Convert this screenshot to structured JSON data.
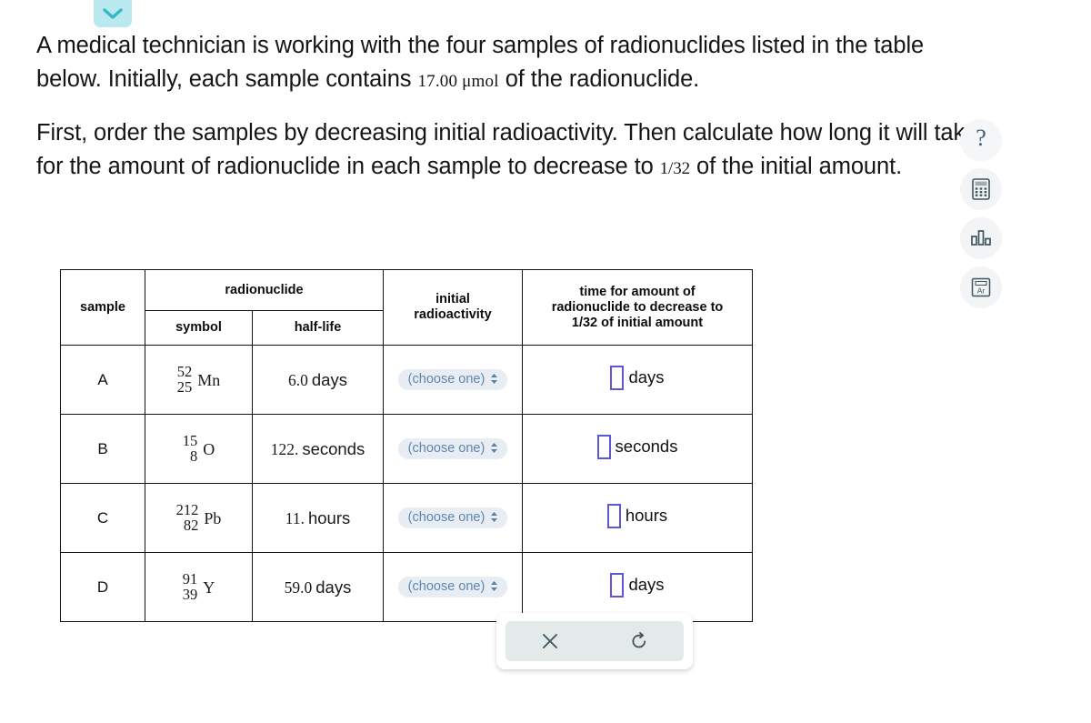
{
  "collapse": {
    "icon": "chevron-down-icon"
  },
  "prompt": {
    "p1_a": "A medical technician is working with the four samples of radionuclides listed in the table below. Initially, each sample contains ",
    "p1_amount": "17.00 μmol",
    "p1_b": " of the radionuclide.",
    "p2_a": "First, order the samples by decreasing initial radioactivity. Then calculate how long it will take for the amount of radionuclide in each sample to decrease to ",
    "p2_frac": "1/32",
    "p2_b": " of the initial amount."
  },
  "tools": [
    {
      "name": "help-icon",
      "label": "?"
    },
    {
      "name": "calculator-icon",
      "label": "calculator"
    },
    {
      "name": "bar-chart-icon",
      "label": "chart"
    },
    {
      "name": "periodic-table-icon",
      "label": "Ar"
    }
  ],
  "table": {
    "headers": {
      "sample": "sample",
      "radionuclide": "radionuclide",
      "symbol": "symbol",
      "half_life": "half-life",
      "initial_radioactivity": "initial\nradioactivity",
      "initial_radioactivity_l1": "initial",
      "initial_radioactivity_l2": "radioactivity",
      "time_l1": "time for amount of",
      "time_l2": "radionuclide to decrease to",
      "time_l3": "1/32 of initial amount"
    },
    "rows": [
      {
        "sample": "A",
        "mass_number": "52",
        "atomic_number": "25",
        "element": "Mn",
        "half_life_value": "6.0",
        "half_life_unit": "days",
        "radioactivity_placeholder": "(choose one)",
        "answer_value": "",
        "answer_unit": "days"
      },
      {
        "sample": "B",
        "mass_number": "15",
        "atomic_number": "8",
        "element": "O",
        "half_life_value": "122.",
        "half_life_unit": "seconds",
        "radioactivity_placeholder": "(choose one)",
        "answer_value": "",
        "answer_unit": "seconds"
      },
      {
        "sample": "C",
        "mass_number": "212",
        "atomic_number": "82",
        "element": "Pb",
        "half_life_value": "11.",
        "half_life_unit": "hours",
        "radioactivity_placeholder": "(choose one)",
        "answer_value": "",
        "answer_unit": "hours"
      },
      {
        "sample": "D",
        "mass_number": "91",
        "atomic_number": "39",
        "element": "Y",
        "half_life_value": "59.0",
        "half_life_unit": "days",
        "radioactivity_placeholder": "(choose one)",
        "answer_value": "",
        "answer_unit": "days"
      }
    ]
  },
  "toolbar": {
    "clear": "clear-icon",
    "reset": "reset-icon"
  },
  "colors": {
    "collapse_bg": "#b9e8ef",
    "dropdown_bg": "#e7edf2",
    "dropdown_text": "#5c87b0",
    "input_border": "#5b57d6",
    "toolbar_inner_bg": "#e4e9ea"
  }
}
